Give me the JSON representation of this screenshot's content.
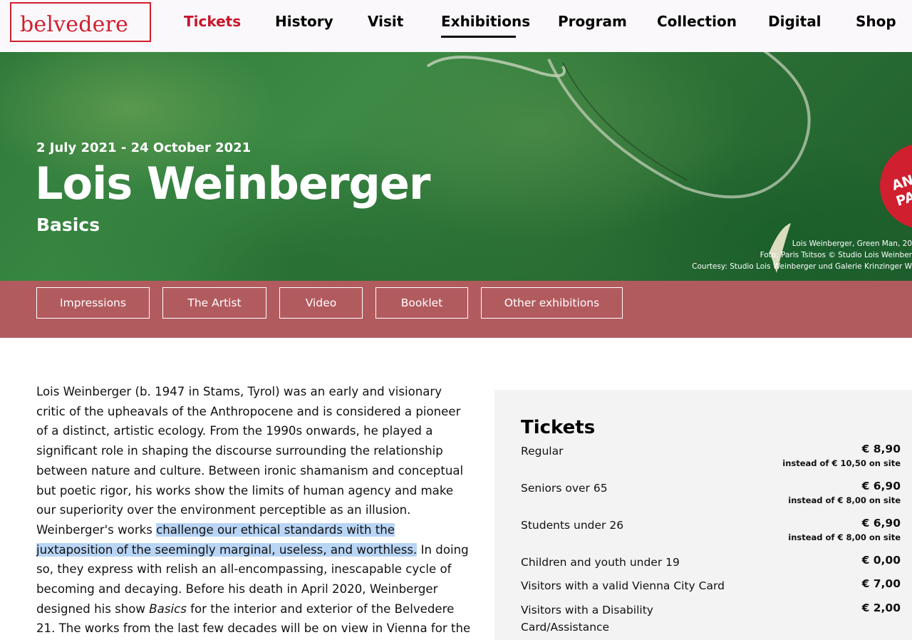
{
  "header": {
    "logo_text": "belvedere",
    "nav": [
      {
        "label": "Tickets",
        "active": true
      },
      {
        "label": "History"
      },
      {
        "label": "Visit"
      },
      {
        "label": "Exhibitions",
        "current": true
      },
      {
        "label": "Program"
      },
      {
        "label": "Collection"
      },
      {
        "label": "Digital"
      },
      {
        "label": "Shop"
      }
    ]
  },
  "hero": {
    "date_range": "2 July 2021 - 24 October 2021",
    "title": "Lois Weinberger",
    "subtitle": "Basics",
    "badge_lines": [
      "AN",
      "PA"
    ],
    "caption": [
      "Lois Weinberger, Green Man, 20",
      "Foto: Paris Tsitsos © Studio Lois Weinber",
      "Courtesy: Studio Lois Weinberger und Galerie Krinzinger W"
    ]
  },
  "subnav": [
    "Impressions",
    "The Artist",
    "Video",
    "Booklet",
    "Other exhibitions"
  ],
  "intro": {
    "before_highlight": "Lois Weinberger (b. 1947 in Stams, Tyrol) was an early and visionary critic of the upheavals of the Anthropocene and is considered a pioneer of a distinct, artistic ecology. From the 1990s onwards, he played a significant role in shaping the discourse surrounding the relationship between nature and culture. Between ironic shamanism and conceptual but poetic rigor, his works show the limits of human agency and make our superiority over the environment perceptible as an illusion. Weinberger's works ",
    "highlight": "challenge our ethical standards with the juxtaposition of the seemingly marginal, useless, and worthless.",
    "after_highlight": " In doing so, they express with relish an all-encompassing, inescapable cycle of becoming and decaying. Before his death in April 2020, Weinberger designed his show ",
    "show_name": "Basics",
    "ending": " for the interior and exterior of the Belvedere 21. The works from the last few decades will be on view in Vienna for the first time."
  },
  "tickets": {
    "title": "Tickets",
    "rows": [
      {
        "label": "Regular",
        "price": "€ 8,90",
        "note": "instead of € 10,50 on site"
      },
      {
        "label": "Seniors over 65",
        "price": "€ 6,90",
        "note": "instead of € 8,00 on site"
      },
      {
        "label": "Students under 26",
        "price": "€ 6,90",
        "note": "instead of € 8,00 on site"
      },
      {
        "label": "Children and youth under 19",
        "price": "€ 0,00"
      },
      {
        "label": "Visitors with a valid Vienna City Card",
        "price": "€ 7,00"
      },
      {
        "label": "Visitors with a Disability Card/Assistance",
        "price": "€ 2,00"
      }
    ]
  },
  "colors": {
    "brand_red": "#d01f2f",
    "nav_active": "#c8152a",
    "band": "#b25b5f",
    "highlight": "#b9d5f5",
    "panel": "#f3f3f3"
  }
}
